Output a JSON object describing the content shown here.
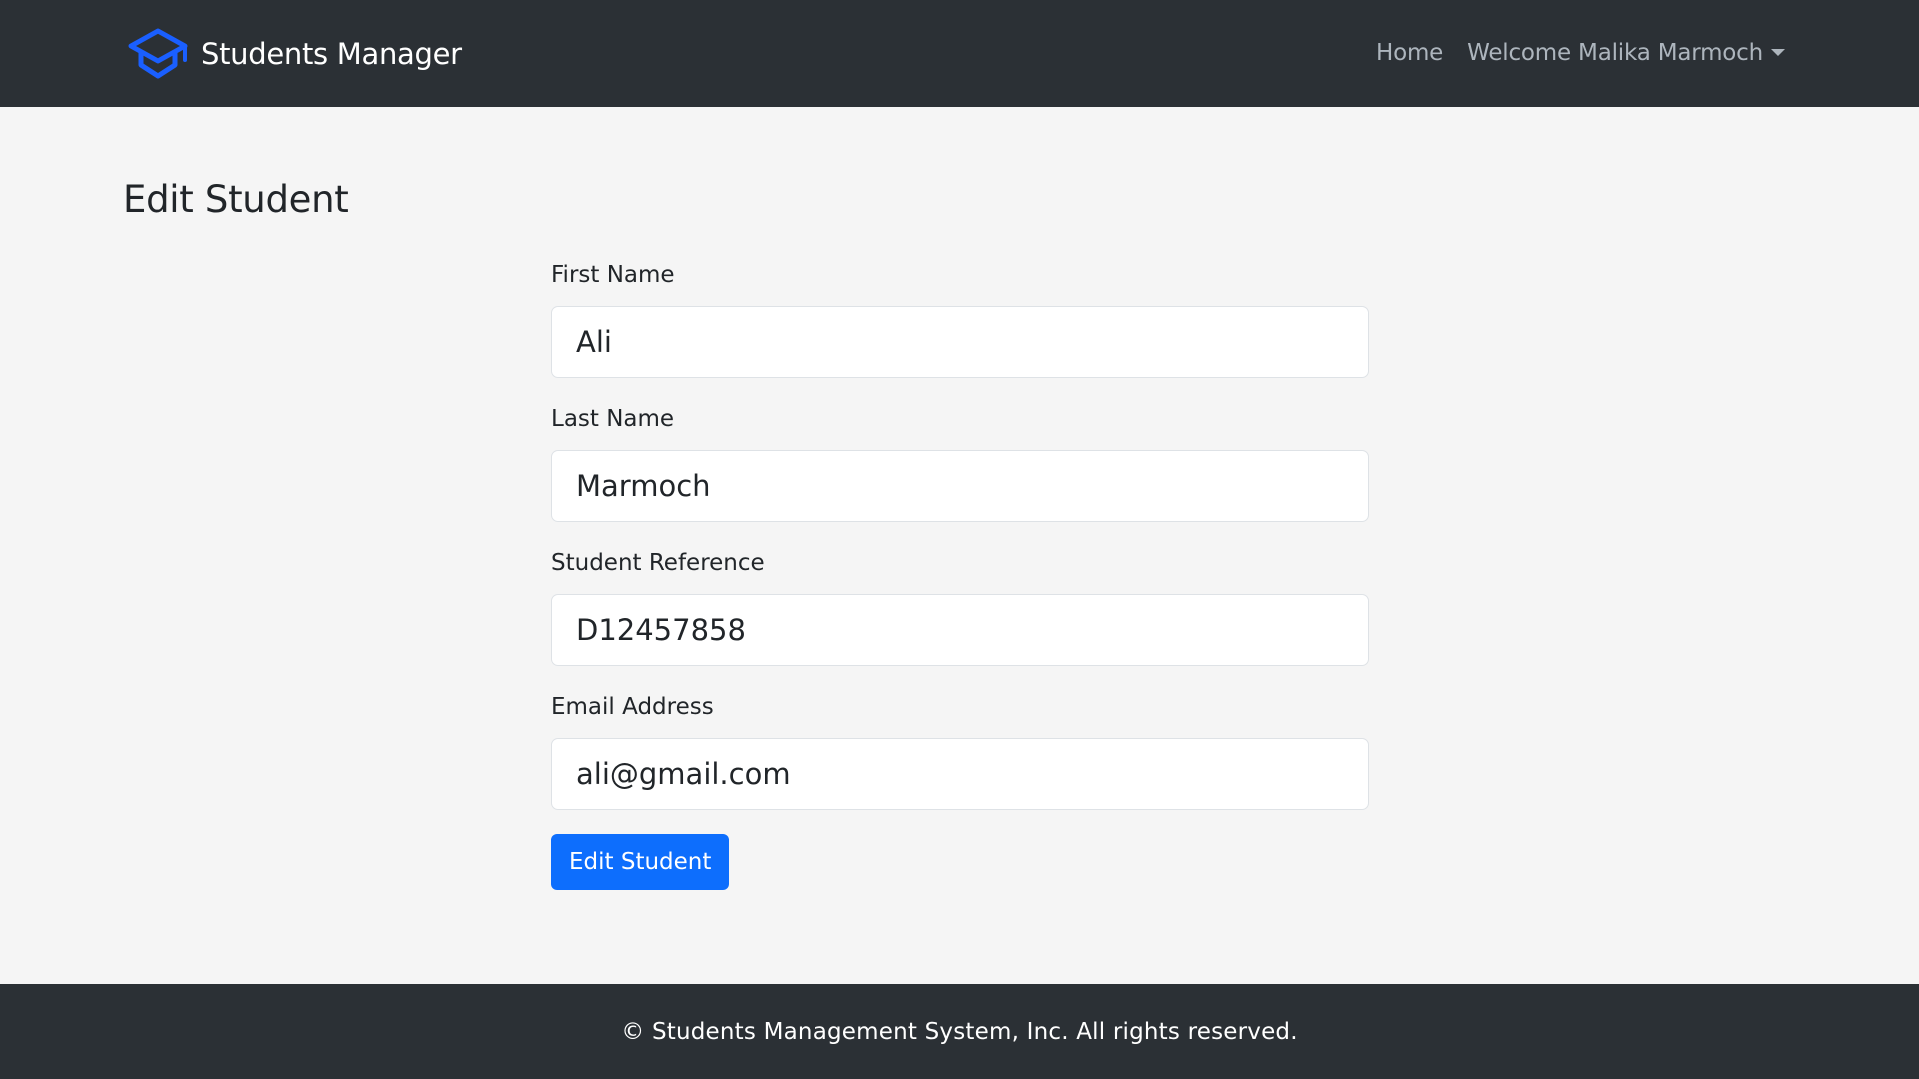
{
  "navbar": {
    "brand_name": "Students Manager",
    "brand_icon": "graduation-cap-icon",
    "home_label": "Home",
    "user_menu_label": "Welcome Malika Marmoch",
    "brand_color": "#1a5fff",
    "background_color": "#2b3035"
  },
  "page": {
    "title": "Edit Student"
  },
  "form": {
    "first_name": {
      "label": "First Name",
      "value": "Ali"
    },
    "last_name": {
      "label": "Last Name",
      "value": "Marmoch"
    },
    "student_reference": {
      "label": "Student Reference",
      "value": "D12457858"
    },
    "email": {
      "label": "Email Address",
      "value": "ali@gmail.com"
    },
    "submit_label": "Edit Student",
    "submit_color": "#0d6efd"
  },
  "footer": {
    "text": "© Students Management System, Inc. All rights reserved."
  }
}
